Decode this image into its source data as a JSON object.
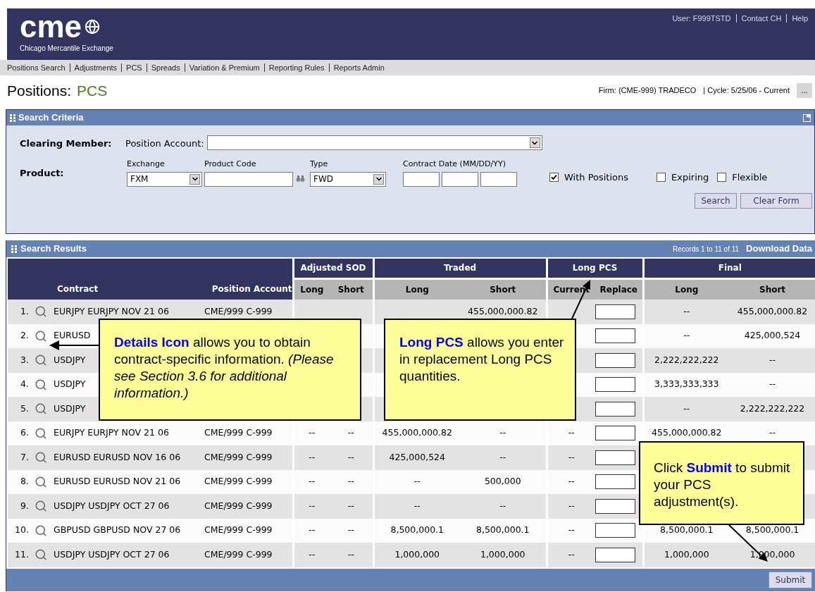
{
  "header": {
    "logo_text": "cme",
    "logo_subtitle": "Chicago Mercantile Exchange",
    "user_links": [
      "User: F999TSTD",
      "Contact CH",
      "Help"
    ]
  },
  "nav": [
    "Positions Search",
    "Adjustments",
    "PCS",
    "Spreads",
    "Variation & Premium",
    "Reporting Rules",
    "Reports Admin"
  ],
  "page_title": {
    "label": "Positions:",
    "section": "PCS"
  },
  "context": {
    "firm": "Firm: (CME-999) TRADECO",
    "cycle": "| Cycle: 5/25/06 - Current",
    "more_button": "..."
  },
  "search_criteria": {
    "title": "Search Criteria",
    "clearing_member_label": "Clearing Member:",
    "position_account_label": "Position Account:",
    "product_label": "Product:",
    "exchange": {
      "label": "Exchange",
      "value": "FXM"
    },
    "product_code": {
      "label": "Product Code"
    },
    "type": {
      "label": "Type",
      "value": "FWD"
    },
    "contract_date": {
      "label": "Contract Date (MM/DD/YY)"
    },
    "checkboxes": [
      {
        "label": "With Positions",
        "checked": true
      },
      {
        "label": "Expiring",
        "checked": false
      },
      {
        "label": "Flexible",
        "checked": false
      }
    ],
    "buttons": [
      "Search",
      "Clear Form"
    ]
  },
  "search_results": {
    "title": "Search Results",
    "records": "Records 1 to 11 of 11",
    "download_link": "Download Data",
    "headers": [
      "Contract",
      "Position Account"
    ],
    "groups": [
      {
        "label": "Adjusted SOD",
        "columns": [
          "Long",
          "Short"
        ]
      },
      {
        "label": "Traded",
        "columns": [
          "Long",
          "Short"
        ]
      },
      {
        "label": "Long PCS",
        "columns": [
          "Current",
          "Replace"
        ]
      },
      {
        "label": "Final",
        "columns": [
          "Long",
          "Short"
        ]
      }
    ],
    "rows": [
      {
        "number": "1.",
        "contract": "EURJPY EURJPY NOV 21 06",
        "account": "CME/999 C-999",
        "traded_short": "455,000,000.82",
        "final_long": "--",
        "final_short": "455,000,000.82"
      },
      {
        "number": "2.",
        "contract": "EURUSD",
        "final_long": "--",
        "final_short": "425,000,524"
      },
      {
        "number": "3.",
        "contract": "USDJPY",
        "final_long": "2,222,222,222",
        "final_short": "--"
      },
      {
        "number": "4.",
        "contract": "USDJPY",
        "final_long": "3,333,333,333",
        "final_short": "--"
      },
      {
        "number": "5.",
        "contract": "USDJPY",
        "final_long": "--",
        "final_short": "2,222,222,222"
      },
      {
        "number": "6.",
        "contract": "EURJPY EURJPY NOV 21 06",
        "account": "CME/999 C-999",
        "sod_long": "--",
        "sod_short": "--",
        "traded_long": "455,000,000.82",
        "traded_short": "--",
        "current": "--",
        "final_long": "455,000,000.82",
        "final_short": "--"
      },
      {
        "number": "7.",
        "contract": "EURUSD EURUSD NOV 16 06",
        "account": "CME/999 C-999",
        "sod_long": "--",
        "sod_short": "--",
        "traded_long": "425,000,524",
        "traded_short": "--",
        "current": "--"
      },
      {
        "number": "8.",
        "contract": "EURUSD EURUSD NOV 21 06",
        "account": "CME/999 C-999",
        "sod_long": "--",
        "sod_short": "--",
        "traded_long": "--",
        "traded_short": "500,000",
        "current": "--"
      },
      {
        "number": "9.",
        "contract": "USDJPY USDJPY OCT 27 06",
        "account": "CME/999 C-999",
        "sod_long": "--",
        "sod_short": "--",
        "traded_long": "--",
        "traded_short": "--",
        "current": "--"
      },
      {
        "number": "10.",
        "contract": "GBPUSD GBPUSD NOV 27 06",
        "account": "CME/999 C-999",
        "sod_long": "--",
        "sod_short": "--",
        "traded_long": "8,500,000.1",
        "traded_short": "8,500,000.1",
        "current": "--",
        "final_long": "8,500,000.1",
        "final_short": "8,500,000.1"
      },
      {
        "number": "11.",
        "contract": "USDJPY USDJPY OCT 27 06",
        "account": "CME/999 C-999",
        "sod_long": "--",
        "sod_short": "--",
        "traded_long": "1,000,000",
        "traded_short": "1,000,000",
        "current": "--",
        "final_long": "1,000,000",
        "final_short": "1,000,000"
      }
    ],
    "submit_button": "Submit"
  },
  "callouts": [
    {
      "text": "**Details Icon** allows you to obtain contract-specific information.  *(Please see Section 3.6 for additional information.)*"
    },
    {
      "text": "**Long PCS** allows you enter in replacement Long PCS quantities."
    },
    {
      "text": "Click **Submit** to submit your PCS adjustment(s)."
    }
  ]
}
